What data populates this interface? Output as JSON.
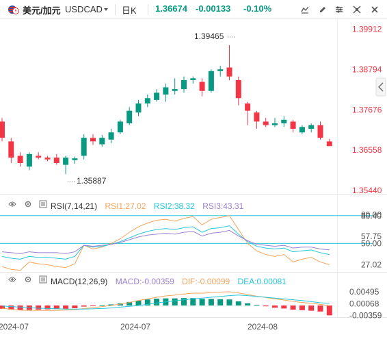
{
  "header": {
    "symbol_name": "美元/加元",
    "symbol_code": "USDCAD",
    "interval": "日K",
    "price": "1.36674",
    "change": "-0.00133",
    "change_percent": "-0.10%"
  },
  "colors": {
    "up": "#089981",
    "down": "#f23645",
    "price_axis_text": "#f23645",
    "rsi1": "#f5a45a",
    "rsi2": "#26c6da",
    "rsi3": "#9b7fd1",
    "macd_label": "#9b7fd1",
    "dif": "#f5a45a",
    "dea": "#26c6da",
    "hline": "#26c6da"
  },
  "price_axis": {
    "ticks": [
      "1.39912",
      "1.38794",
      "1.37676",
      "1.36558",
      "1.35440"
    ],
    "high_label": "1.39465",
    "low_label": "1.35887"
  },
  "rsi": {
    "title": "RSI(7,14,21)",
    "rsi1": "RSI1:27.02",
    "rsi2": "RSI2:38.32",
    "rsi3": "RSI3:43.31",
    "axis_labels": [
      "80.00",
      "80.40",
      "57.75",
      "50.00",
      "27.02"
    ]
  },
  "macd": {
    "title": "MACD(12,26,9)",
    "macd": "MACD:-0.00359",
    "dif": "DIF:-0.00099",
    "dea": "DEA:0.00081",
    "axis_labels": [
      "0.00495",
      "0.00068",
      "-0.00359"
    ]
  },
  "time_axis": {
    "labels": [
      "2024-07",
      "2024-07",
      "2024-08"
    ]
  },
  "chart_data": {
    "type": "candlestick",
    "ylim": [
      1.3544,
      1.4
    ],
    "candles": [
      {
        "o": 1.3735,
        "h": 1.3745,
        "l": 1.368,
        "c": 1.369
      },
      {
        "o": 1.368,
        "h": 1.369,
        "l": 1.362,
        "c": 1.3635
      },
      {
        "o": 1.364,
        "h": 1.365,
        "l": 1.361,
        "c": 1.362
      },
      {
        "o": 1.361,
        "h": 1.365,
        "l": 1.36,
        "c": 1.3645
      },
      {
        "o": 1.364,
        "h": 1.365,
        "l": 1.363,
        "c": 1.3635
      },
      {
        "o": 1.3635,
        "h": 1.364,
        "l": 1.3625,
        "c": 1.363
      },
      {
        "o": 1.3635,
        "h": 1.3645,
        "l": 1.3615,
        "c": 1.362
      },
      {
        "o": 1.3615,
        "h": 1.364,
        "l": 1.3589,
        "c": 1.3635
      },
      {
        "o": 1.3628,
        "h": 1.3638,
        "l": 1.3618,
        "c": 1.3633
      },
      {
        "o": 1.364,
        "h": 1.37,
        "l": 1.363,
        "c": 1.369
      },
      {
        "o": 1.369,
        "h": 1.37,
        "l": 1.367,
        "c": 1.368
      },
      {
        "o": 1.3672,
        "h": 1.3698,
        "l": 1.3665,
        "c": 1.369
      },
      {
        "o": 1.3685,
        "h": 1.3715,
        "l": 1.3675,
        "c": 1.3705
      },
      {
        "o": 1.3705,
        "h": 1.374,
        "l": 1.37,
        "c": 1.3735
      },
      {
        "o": 1.373,
        "h": 1.3775,
        "l": 1.3725,
        "c": 1.3765
      },
      {
        "o": 1.376,
        "h": 1.3795,
        "l": 1.375,
        "c": 1.3785
      },
      {
        "o": 1.3785,
        "h": 1.381,
        "l": 1.3775,
        "c": 1.38
      },
      {
        "o": 1.3795,
        "h": 1.3825,
        "l": 1.379,
        "c": 1.3815
      },
      {
        "o": 1.381,
        "h": 1.384,
        "l": 1.379,
        "c": 1.383
      },
      {
        "o": 1.382,
        "h": 1.3855,
        "l": 1.381,
        "c": 1.3825
      },
      {
        "o": 1.3825,
        "h": 1.386,
        "l": 1.3815,
        "c": 1.385
      },
      {
        "o": 1.385,
        "h": 1.386,
        "l": 1.384,
        "c": 1.3855
      },
      {
        "o": 1.3845,
        "h": 1.3855,
        "l": 1.3805,
        "c": 1.382
      },
      {
        "o": 1.382,
        "h": 1.388,
        "l": 1.3815,
        "c": 1.3875
      },
      {
        "o": 1.3875,
        "h": 1.389,
        "l": 1.386,
        "c": 1.388
      },
      {
        "o": 1.3885,
        "h": 1.3947,
        "l": 1.385,
        "c": 1.386
      },
      {
        "o": 1.385,
        "h": 1.386,
        "l": 1.378,
        "c": 1.38
      },
      {
        "o": 1.3785,
        "h": 1.379,
        "l": 1.3725,
        "c": 1.3765
      },
      {
        "o": 1.376,
        "h": 1.3765,
        "l": 1.3715,
        "c": 1.3735
      },
      {
        "o": 1.3735,
        "h": 1.3745,
        "l": 1.372,
        "c": 1.3725
      },
      {
        "o": 1.3725,
        "h": 1.3745,
        "l": 1.372,
        "c": 1.373
      },
      {
        "o": 1.373,
        "h": 1.375,
        "l": 1.372,
        "c": 1.374
      },
      {
        "o": 1.3735,
        "h": 1.374,
        "l": 1.3705,
        "c": 1.3715
      },
      {
        "o": 1.3705,
        "h": 1.3725,
        "l": 1.37,
        "c": 1.372
      },
      {
        "o": 1.3715,
        "h": 1.373,
        "l": 1.3705,
        "c": 1.3725
      },
      {
        "o": 1.3725,
        "h": 1.3735,
        "l": 1.3685,
        "c": 1.369
      },
      {
        "o": 1.368,
        "h": 1.3687,
        "l": 1.3667,
        "c": 1.3667
      }
    ],
    "rsi_series": [
      {
        "name": "RSI1",
        "values": [
          25,
          22,
          21,
          30,
          28,
          27,
          25,
          24,
          28,
          48,
          44,
          46,
          50,
          55,
          62,
          68,
          72,
          75,
          76,
          74,
          77,
          79,
          70,
          76,
          78,
          80,
          65,
          50,
          42,
          38,
          36,
          38,
          30,
          33,
          35,
          30,
          27
        ]
      },
      {
        "name": "RSI2",
        "values": [
          36,
          34,
          33,
          36,
          35,
          35,
          34,
          33,
          36,
          48,
          46,
          47,
          49,
          52,
          56,
          60,
          63,
          65,
          66,
          65,
          67,
          68,
          62,
          66,
          67,
          69,
          60,
          52,
          47,
          45,
          44,
          45,
          41,
          42,
          43,
          40,
          38
        ]
      },
      {
        "name": "RSI3",
        "values": [
          41,
          40,
          39,
          41,
          40,
          40,
          40,
          39,
          41,
          48,
          47,
          48,
          49,
          51,
          54,
          57,
          59,
          60,
          61,
          60,
          62,
          63,
          58,
          61,
          62,
          64,
          58,
          53,
          49,
          48,
          47,
          48,
          45,
          46,
          46,
          44,
          43
        ]
      }
    ],
    "rsi_ylim": [
      20,
      85
    ],
    "macd_hist": [
      -0.0012,
      -0.0015,
      -0.0017,
      -0.0016,
      -0.0015,
      -0.0014,
      -0.0013,
      -0.0012,
      -0.001,
      -0.0004,
      -0.0002,
      0.0001,
      0.0004,
      0.0008,
      0.0013,
      0.0018,
      0.0022,
      0.0025,
      0.0026,
      0.0026,
      0.0027,
      0.0027,
      0.0024,
      0.0024,
      0.0023,
      0.0022,
      0.0015,
      0.0008,
      0.0002,
      -0.0003,
      -0.0008,
      -0.0011,
      -0.0015,
      -0.0017,
      -0.0019,
      -0.0022,
      -0.0036
    ],
    "macd_dif": [
      -0.001,
      -0.0014,
      -0.0017,
      -0.0018,
      -0.0018,
      -0.0018,
      -0.0018,
      -0.0017,
      -0.0016,
      -0.0011,
      -0.0008,
      -0.0004,
      0.0,
      0.0005,
      0.0011,
      0.0018,
      0.0024,
      0.003,
      0.0035,
      0.0038,
      0.0042,
      0.0045,
      0.0045,
      0.0047,
      0.0049,
      0.005,
      0.0046,
      0.004,
      0.0034,
      0.0029,
      0.0024,
      0.002,
      0.0015,
      0.0011,
      0.0008,
      0.0004,
      -0.0001
    ],
    "macd_dea": [
      -0.0002,
      -0.0004,
      -0.0006,
      -0.0008,
      -0.001,
      -0.0011,
      -0.0012,
      -0.0013,
      -0.0013,
      -0.0013,
      -0.0012,
      -0.0011,
      -0.0009,
      -0.0006,
      -0.0003,
      0.0,
      0.0004,
      0.0009,
      0.0013,
      0.0017,
      0.0021,
      0.0024,
      0.0027,
      0.003,
      0.0033,
      0.0036,
      0.0038,
      0.0036,
      0.0033,
      0.003,
      0.0027,
      0.0024,
      0.0021,
      0.0018,
      0.0014,
      0.001,
      0.0008
    ],
    "macd_ylim": [
      -0.0045,
      0.006
    ]
  }
}
